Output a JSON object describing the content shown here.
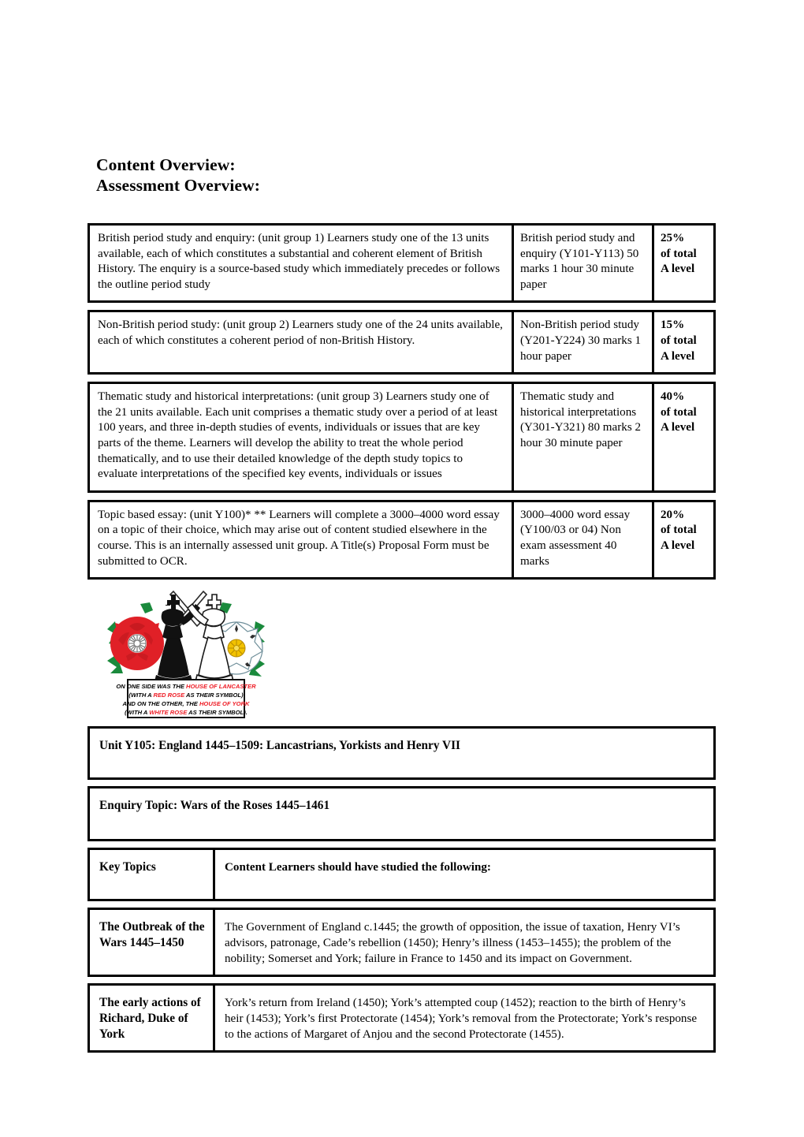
{
  "document": {
    "headings": [
      "Content Overview:",
      "Assessment Overview:"
    ]
  },
  "assessment_table": {
    "rows": [
      {
        "description": "British period study and enquiry: (unit group 1) Learners study one of the 13 units available, each of which constitutes a substantial and coherent element of British History. The enquiry is a source-based study which immediately precedes or follows the outline period study",
        "assessment": "British period study and enquiry (Y101-Y113) 50 marks 1 hour 30 minute paper",
        "weight_percent": "25%",
        "weight_line2": "of total",
        "weight_line3": "A level"
      },
      {
        "description": "Non-British period study: (unit group 2) Learners study one of the 24 units available, each of which constitutes a coherent period of non-British History.",
        "assessment": "Non-British period study (Y201-Y224) 30 marks 1 hour paper",
        "weight_percent": "15%",
        "weight_line2": "of total",
        "weight_line3": "A level"
      },
      {
        "description": "Thematic study and historical interpretations: (unit group 3) Learners study one of the 21 units available. Each unit comprises a thematic study over a period of at least 100 years, and three in-depth studies of events, individuals or issues that are key parts of the theme. Learners will develop the ability to treat the whole period thematically, and to use their detailed knowledge of the depth study topics to evaluate interpretations of the specified key events, individuals or issues",
        "assessment": "Thematic study and historical interpretations (Y301-Y321) 80 marks 2 hour 30 minute paper",
        "weight_percent": "40%",
        "weight_line2": "of total",
        "weight_line3": "A level"
      },
      {
        "description": "Topic based essay: (unit Y100)* ** Learners will complete a 3000–4000 word essay on a topic of their choice, which may arise out of content studied elsewhere in the course. This is an internally assessed unit group. A Title(s) Proposal Form must be submitted to OCR.",
        "assessment": "3000–4000 word essay (Y100/03 or 04) Non exam assessment 40 marks",
        "weight_percent": "20%",
        "weight_line2": "of total",
        "weight_line3": "A level"
      }
    ]
  },
  "illustration": {
    "name": "wars-of-the-roses-illustration",
    "caption_lines": [
      {
        "parts": [
          {
            "text": "ON ONE SIDE WAS THE ",
            "color": "#000000"
          },
          {
            "text": "HOUSE OF LANCASTER",
            "color": "#ee1b24"
          }
        ]
      },
      {
        "parts": [
          {
            "text": "(WITH A ",
            "color": "#000000"
          },
          {
            "text": "RED ROSE",
            "color": "#ee1b24"
          },
          {
            "text": " AS THEIR SYMBOL)",
            "color": "#000000"
          }
        ]
      },
      {
        "parts": [
          {
            "text": "AND ON THE OTHER, THE ",
            "color": "#000000"
          },
          {
            "text": "HOUSE OF YORK",
            "color": "#ee1b24"
          }
        ]
      },
      {
        "parts": [
          {
            "text": "(WITH A ",
            "color": "#000000"
          },
          {
            "text": "WHITE ROSE",
            "color": "#ee1b24"
          },
          {
            "text": " AS THEIR SYMBOL).",
            "color": "#000000"
          }
        ]
      }
    ],
    "colors": {
      "red_rose": "#e02027",
      "rose_leaf": "#1a8a3c",
      "white_rose": "#ffffff",
      "white_rose_center": "#f2c200",
      "black_king": "#1a1a1a",
      "accent_red_text": "#ee1b24"
    }
  },
  "unit_table": {
    "unit_title": "Unit Y105: England 1445–1509: Lancastrians, Yorkists and Henry VII",
    "enquiry_topic": "Enquiry Topic: Wars of the Roses 1445–1461",
    "header": {
      "key_topics_label": "Key Topics",
      "content_label": "Content Learners should have studied the following:"
    },
    "rows": [
      {
        "key_topic": "The Outbreak of the Wars 1445–1450",
        "content": "The Government of England c.1445; the growth of opposition, the issue of taxation, Henry VI’s advisors, patronage, Cade’s rebellion (1450); Henry’s illness (1453–1455); the problem of the nobility; Somerset and York; failure in France to 1450 and its impact on Government."
      },
      {
        "key_topic": "The early actions of Richard, Duke of York",
        "content": "York’s return from Ireland (1450); York’s attempted coup (1452); reaction to the birth of Henry’s heir (1453); York’s first Protectorate (1454); York’s removal from the Protectorate; York’s response to the actions of Margaret of Anjou and the second Protectorate (1455)."
      }
    ]
  }
}
